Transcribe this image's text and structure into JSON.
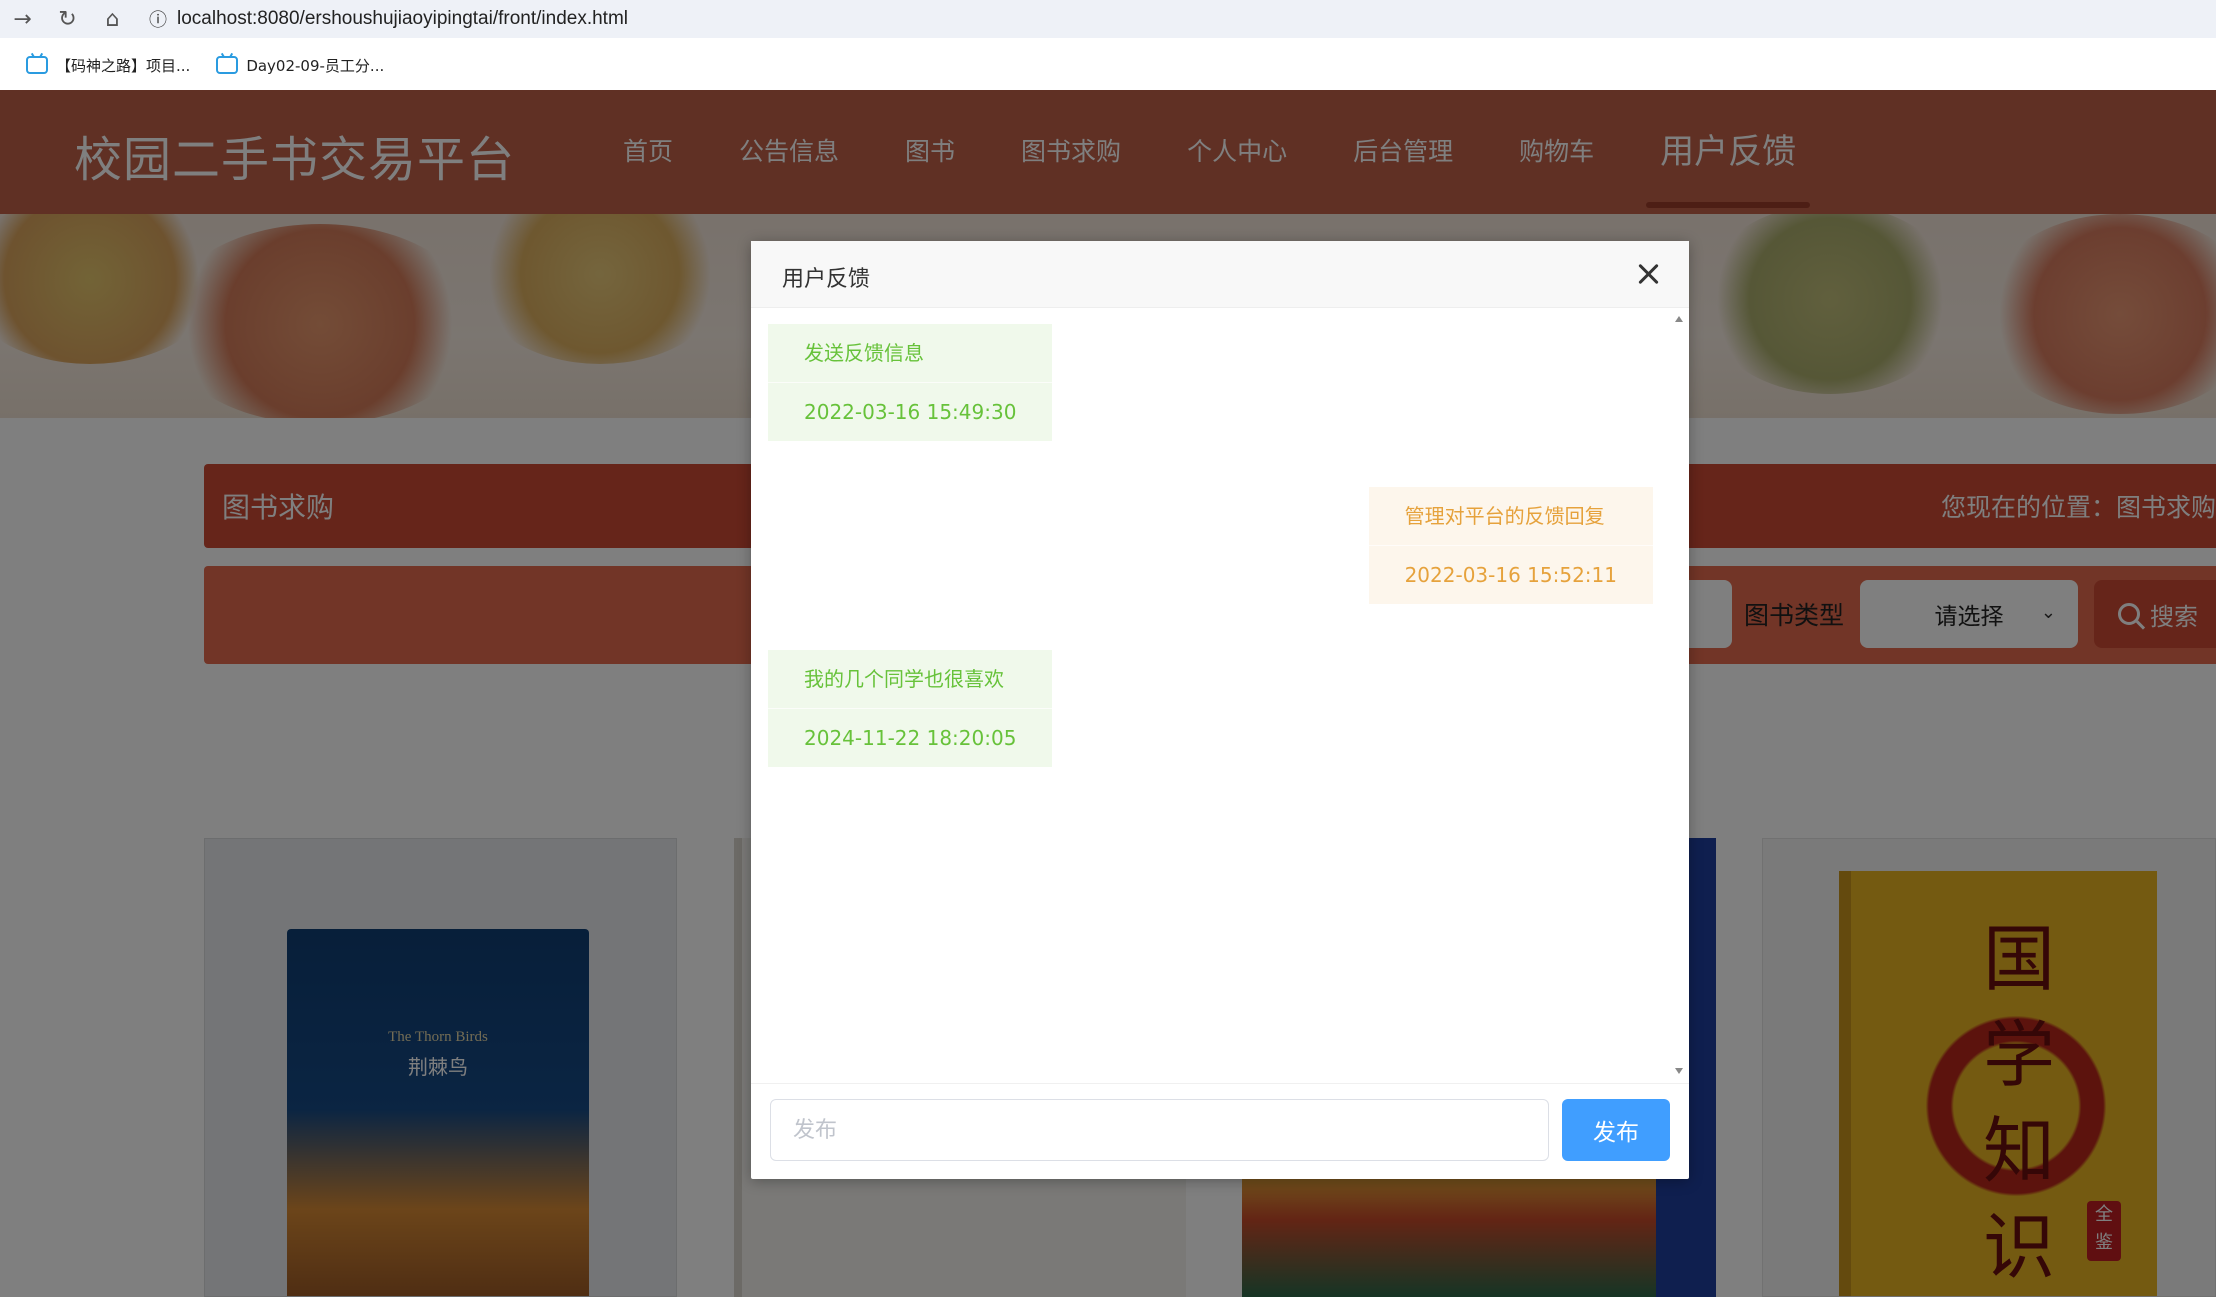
{
  "browser": {
    "url": "localhost:8080/ershoushujiaoyipingtai/front/index.html",
    "bookmarks": [
      {
        "label": "【码神之路】项目..."
      },
      {
        "label": "Day02-09-员工分..."
      }
    ]
  },
  "site": {
    "title": "校园二手书交易平台",
    "nav": [
      {
        "label": "首页"
      },
      {
        "label": "公告信息"
      },
      {
        "label": "图书"
      },
      {
        "label": "图书求购"
      },
      {
        "label": "个人中心"
      },
      {
        "label": "后台管理"
      },
      {
        "label": "购物车"
      },
      {
        "label": "用户反馈",
        "active": true
      }
    ]
  },
  "page": {
    "section_title": "图书求购",
    "location": "您现在的位置：图书求购",
    "filter": {
      "type_label": "图书类型",
      "type_select": "请选择",
      "search_button": "搜索"
    },
    "book1": {
      "en_title": "The Thorn Birds",
      "cn_title": "荆棘鸟"
    },
    "book4": {
      "title_chars": "国学知识",
      "stamp": "全鉴"
    }
  },
  "dialog": {
    "title": "用户反馈",
    "messages": [
      {
        "role": "user",
        "text": "发送反馈信息",
        "time": "2022-03-16 15:49:30"
      },
      {
        "role": "admin",
        "text": "管理对平台的反馈回复",
        "time": "2022-03-16 15:52:11"
      },
      {
        "role": "user",
        "text": "我的几个同学也很喜欢",
        "time": "2024-11-22 18:20:05"
      }
    ],
    "input_placeholder": "发布",
    "submit_label": "发布"
  },
  "colors": {
    "header": "#c06148",
    "crumb_bar": "#cc4b35",
    "search_bar": "#e46a4e",
    "user_bubble_bg": "#f0f9eb",
    "user_bubble_text": "#67c23a",
    "admin_bubble_bg": "#fdf6ec",
    "admin_bubble_text": "#e6a23c",
    "primary_button": "#409eff"
  }
}
